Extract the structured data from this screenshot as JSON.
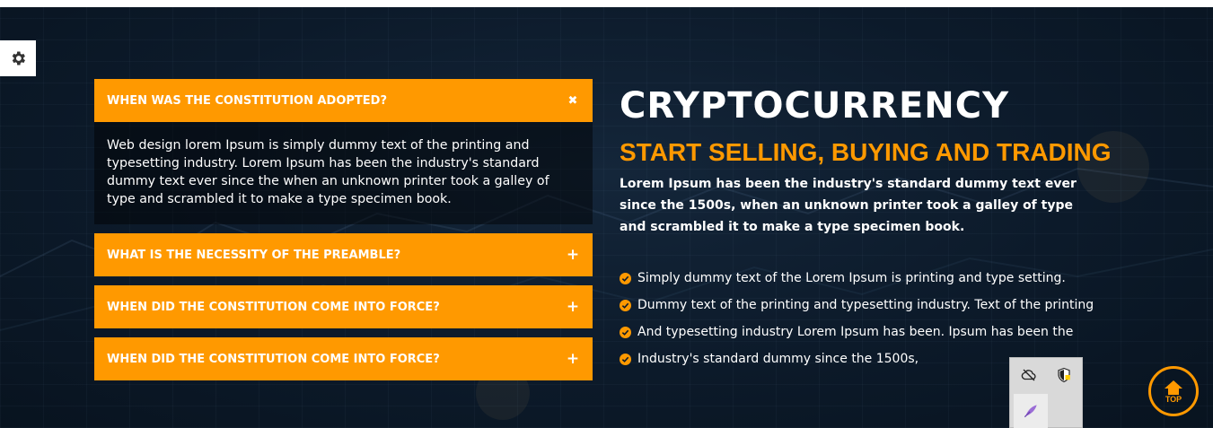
{
  "faq": {
    "items": [
      {
        "question": "WHEN WAS THE CONSTITUTION ADOPTED?",
        "toggle": "✖",
        "answer": "Web design lorem Ipsum is simply dummy text of the printing and typesetting industry. Lorem Ipsum has been the industry's standard dummy text ever since the when an unknown printer took a galley of type and scrambled it to make a type specimen book."
      },
      {
        "question": "WHAT IS THE NECESSITY OF THE PREAMBLE?",
        "toggle": "+"
      },
      {
        "question": "WHEN DID THE CONSTITUTION COME INTO FORCE?",
        "toggle": "+"
      },
      {
        "question": "WHEN DID THE CONSTITUTION COME INTO FORCE?",
        "toggle": "+"
      }
    ]
  },
  "main": {
    "title": "CRYPTOCURRENCY",
    "subtitle": "START SELLING, BUYING AND TRADING",
    "lead": "Lorem Ipsum has been the industry's standard dummy text ever since the 1500s, when an unknown printer took a galley of type and scrambled it to make a type specimen book.",
    "bullets": [
      "Simply dummy text of the Lorem Ipsum is printing and type setting.",
      "Dummy text of the printing and typesetting industry. Text of the printing",
      "And typesetting industry Lorem Ipsum has been. Ipsum has been the",
      "Industry's standard dummy since the 1500s,"
    ]
  },
  "back_to_top": {
    "label": "TOP"
  },
  "icons": {
    "settings": "gear-icon",
    "check": "check-circle-icon",
    "hidden_cloud": "cloud-off-icon",
    "shield": "shield-icon",
    "feather": "feather-icon",
    "arrow_up": "house-arrow-up-icon"
  },
  "colors": {
    "accent": "#ff9900",
    "background": "#0c1a2a",
    "text": "#ffffff"
  }
}
